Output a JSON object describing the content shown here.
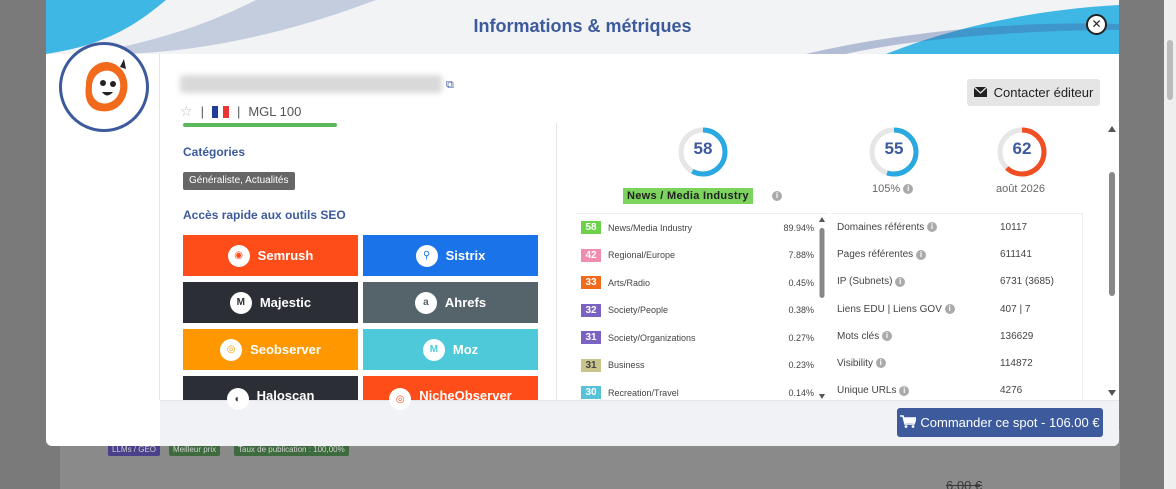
{
  "modal": {
    "title": "Informations & métriques",
    "close_icon": "close-icon"
  },
  "site": {
    "mgl": "MGL 100",
    "separator": "|",
    "flag": "flag-france-icon",
    "contact_label": "Contacter éditeur"
  },
  "sections": {
    "categories_title": "Catégories",
    "categories_value": "Généraliste, Actualités",
    "tools_title": "Accès rapide aux outils SEO"
  },
  "tools": [
    {
      "label": "Semrush",
      "color": "#ff4d1a",
      "icon": "semrush-icon"
    },
    {
      "label": "Sistrix",
      "color": "#1a73e8",
      "icon": "sistrix-search-icon"
    },
    {
      "label": "Majestic",
      "color": "#2b2f35",
      "icon": "majestic-icon"
    },
    {
      "label": "Ahrefs",
      "color": "#55636b",
      "icon": "ahrefs-icon"
    },
    {
      "label": "Seobserver",
      "color": "#ff9800",
      "icon": "seobserver-icon"
    },
    {
      "label": "Moz",
      "color": "#4ec9d9",
      "icon": "moz-icon"
    },
    {
      "label": "Haloscan",
      "color": "#2b2f35",
      "icon": "haloscan-icon"
    },
    {
      "label": "NicheObserver",
      "color": "#ff4d1a",
      "icon": "nicheobserver-icon"
    }
  ],
  "gauges": [
    {
      "value": "58",
      "fraction": 0.58,
      "color": "#2aa8e0",
      "sub": ""
    },
    {
      "value": "55",
      "fraction": 0.55,
      "color": "#2aa8e0",
      "sub": "105%"
    },
    {
      "value": "62",
      "fraction": 0.62,
      "color": "#f04e23",
      "sub": "août 2026"
    }
  ],
  "news_badge": "News / Media Industry",
  "topics": [
    {
      "score": "58",
      "name": "News/Media Industry",
      "pct": "89.94%",
      "color": "#6dd14a"
    },
    {
      "score": "42",
      "name": "Regional/Europe",
      "pct": "7.88%",
      "color": "#f08cb0"
    },
    {
      "score": "33",
      "name": "Arts/Radio",
      "pct": "0.45%",
      "color": "#f26a1b"
    },
    {
      "score": "32",
      "name": "Society/People",
      "pct": "0.38%",
      "color": "#7a62c2"
    },
    {
      "score": "31",
      "name": "Society/Organizations",
      "pct": "0.27%",
      "color": "#7a62c2"
    },
    {
      "score": "31",
      "name": "Business",
      "pct": "0.23%",
      "color": "#c9c48a"
    },
    {
      "score": "30",
      "name": "Recreation/Travel",
      "pct": "0.14%",
      "color": "#57c2d8"
    }
  ],
  "metrics": [
    {
      "label": "Domaines référents",
      "value": "10117"
    },
    {
      "label": "Pages référentes",
      "value": "611141"
    },
    {
      "label": "IP (Subnets)",
      "value": "6731 (3685)"
    },
    {
      "label": "Liens EDU | Liens GOV",
      "value": "407 | 7"
    },
    {
      "label": "Mots clés",
      "value": "136629"
    },
    {
      "label": "Visibility",
      "value": "114872"
    },
    {
      "label": "Unique URLs",
      "value": "4276"
    }
  ],
  "order_label": "Commander ce spot - 106.00 €",
  "background": {
    "tags": [
      "LLMs / GEO",
      "Meilleur prix",
      "Taux de publication : 100,00%"
    ],
    "price": "6.00 €"
  }
}
